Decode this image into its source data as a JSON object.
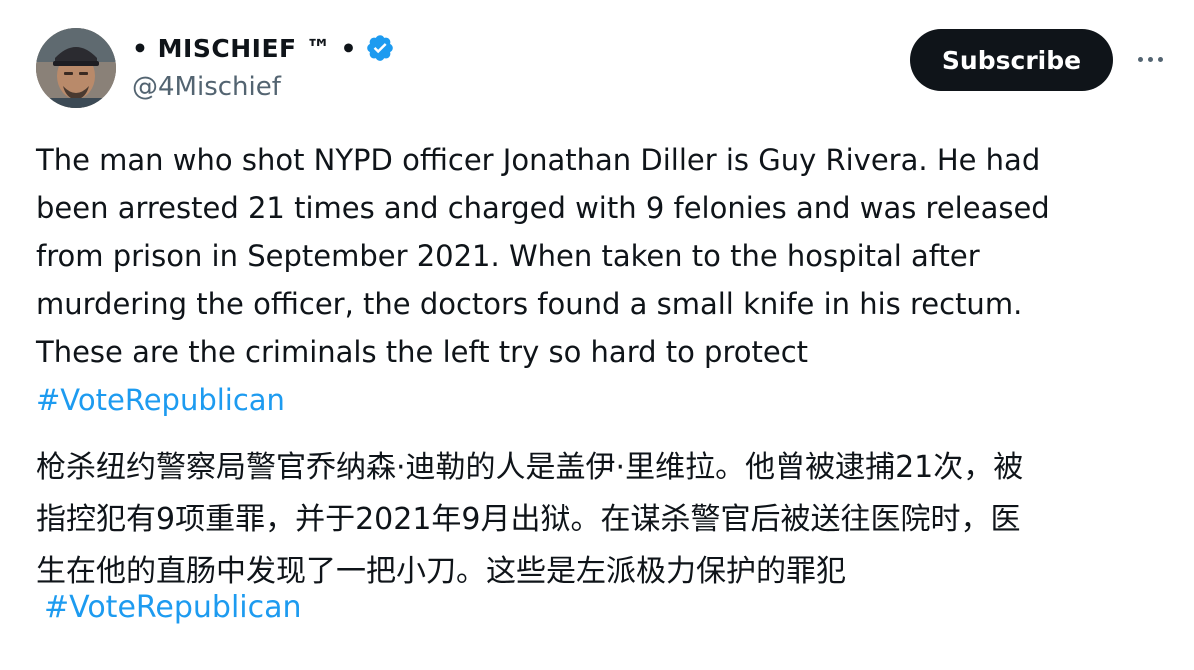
{
  "author": {
    "display_name": "• MISCHIEF ™ •",
    "handle": "@4Mischief",
    "verified": true,
    "avatar_icon": "avatar-photo"
  },
  "actions": {
    "subscribe_label": "Subscribe",
    "more_icon": "more-horizontal-icon"
  },
  "colors": {
    "text": "#0f1419",
    "secondary": "#536471",
    "link": "#1d9bf0",
    "verified_badge": "#1d9bf0",
    "button_bg": "#0f1419"
  },
  "tweet": {
    "english_lines": [
      "The man who shot NYPD officer Jonathan Diller is Guy Rivera. He had",
      "been arrested 21 times and charged with 9 felonies and was released",
      "from prison in September 2021. When taken to the hospital after",
      "murdering the officer, the doctors found a small knife in his rectum.",
      "These are the criminals the left try so hard to protect"
    ],
    "hashtag": "#VoteRepublican",
    "chinese_lines": [
      "枪杀纽约警察局警官乔纳森·迪勒的人是盖伊·里维拉。他曾被逮捕21次，被",
      "指控犯有9项重罪，并于2021年9月出狱。在谋杀警官后被送往医院时，医",
      "生在他的直肠中发现了一把小刀。这些是左派极力保护的罪犯"
    ],
    "hashtag_zh": "#VoteRepublican"
  }
}
